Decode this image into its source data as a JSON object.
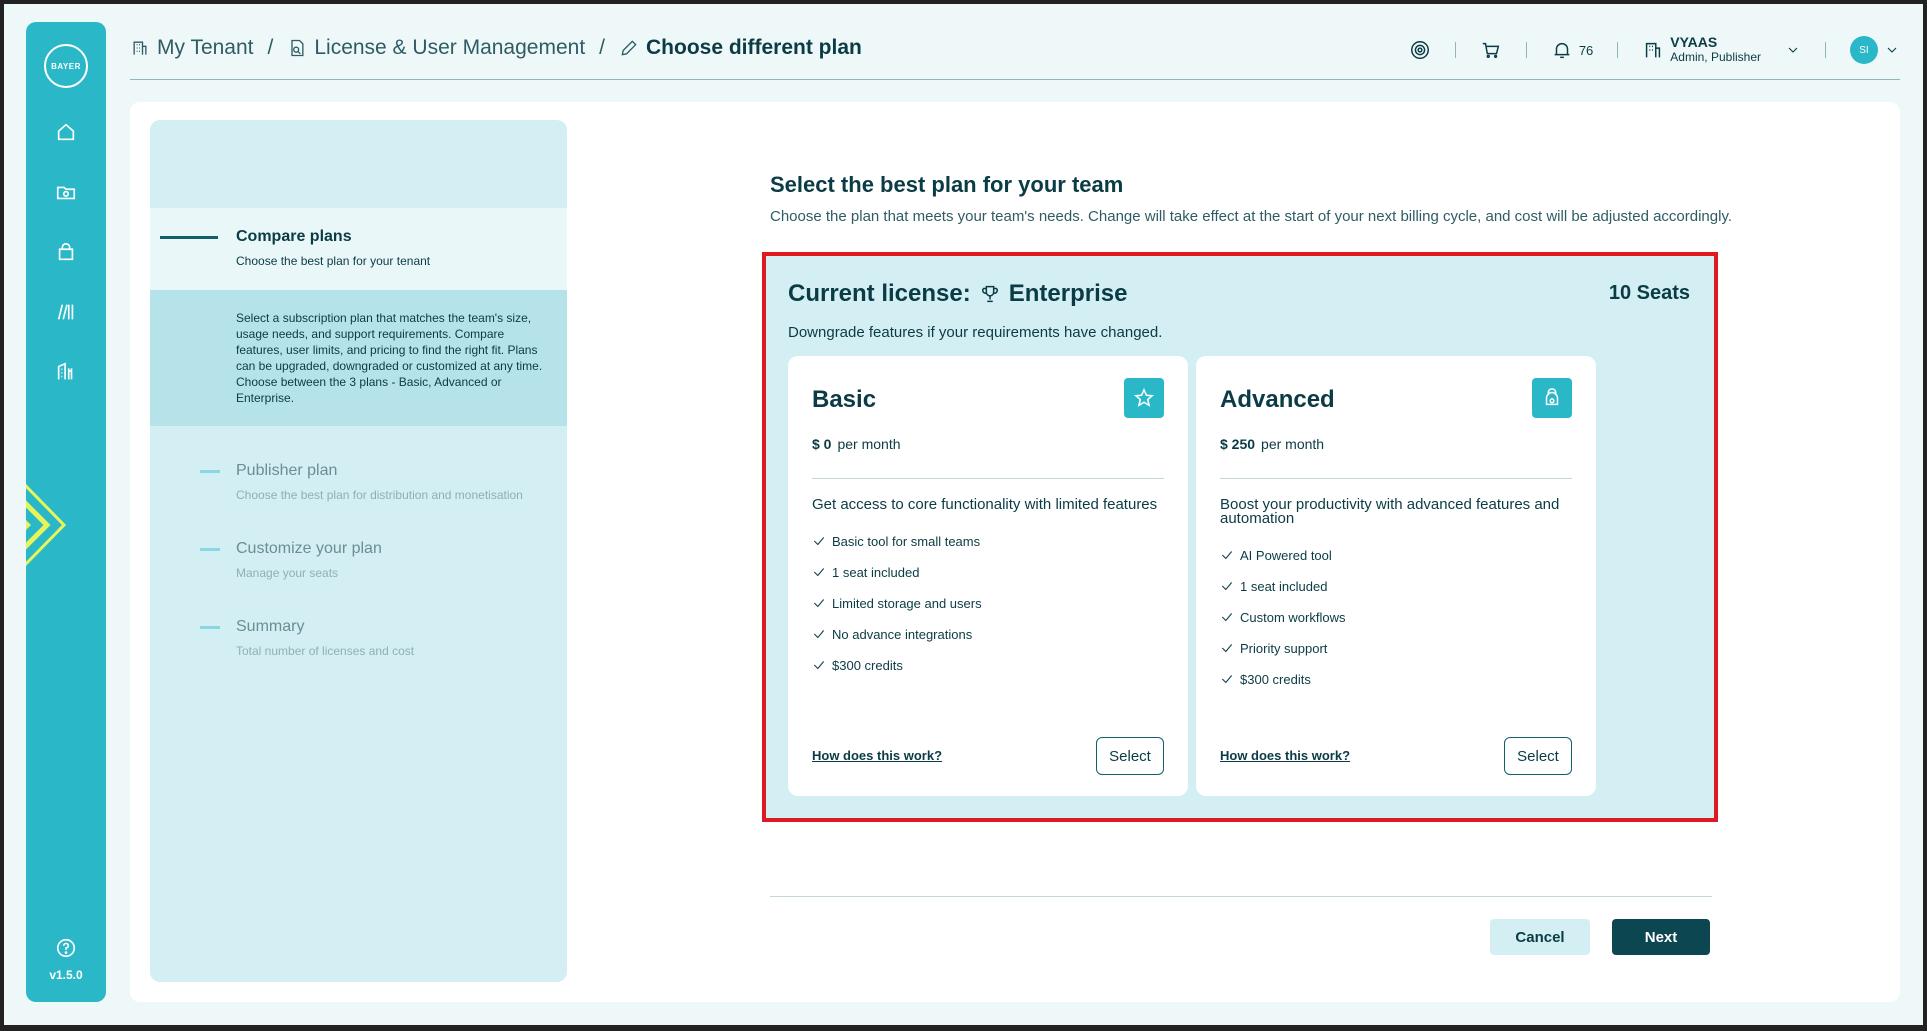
{
  "sidebar": {
    "logo_text": "BAYER",
    "version": "v1.5.0",
    "items": [
      {
        "icon": "home-icon"
      },
      {
        "icon": "folder-icon"
      },
      {
        "icon": "bag-icon"
      },
      {
        "icon": "library-icon"
      },
      {
        "icon": "building-tools-icon"
      }
    ],
    "help_icon": "help-icon"
  },
  "breadcrumb": {
    "items": [
      "My Tenant",
      "License & User Management",
      "Choose different plan"
    ],
    "separator": "/"
  },
  "header": {
    "notifications_count": "76",
    "user_name": "VYAAS",
    "user_role": "Admin, Publisher",
    "avatar_initials": "SI"
  },
  "stepper": {
    "steps": [
      {
        "title": "Compare plans",
        "subtitle": "Choose the best plan for your tenant"
      },
      {
        "title": "Publisher plan",
        "subtitle": "Choose the best plan for distribution and monetisation"
      },
      {
        "title": "Customize your plan",
        "subtitle": "Manage your seats"
      },
      {
        "title": "Summary",
        "subtitle": "Total number of licenses and cost"
      }
    ],
    "active_description": "Select a subscription plan that matches the team's size, usage needs, and support requirements. Compare features, user limits, and pricing to find the right fit. Plans can be upgraded, downgraded or customized at any time. Choose between the 3 plans - Basic, Advanced or Enterprise."
  },
  "main": {
    "heading": "Select the best plan for your team",
    "subheading": "Choose the plan that meets your team's needs. Change will take effect at the start of your next billing cycle, and cost will be adjusted accordingly."
  },
  "license": {
    "label": "Current license:",
    "plan": "Enterprise",
    "seats": "10 Seats",
    "subtitle": "Downgrade features if your requirements have changed."
  },
  "plans": [
    {
      "name": "Basic",
      "icon": "star-icon",
      "price": "$ 0",
      "period": "per month",
      "description": "Get access to core functionality with limited features",
      "features": [
        "Basic tool for small teams",
        "1 seat included",
        "Limited storage and users",
        "No advance integrations",
        "$300 credits"
      ],
      "how_link": "How does this work?",
      "select_label": "Select"
    },
    {
      "name": "Advanced",
      "icon": "kettlebell-icon",
      "price": "$ 250",
      "period": "per month",
      "description": "Boost your productivity with advanced features and automation",
      "features": [
        "AI Powered tool",
        "1 seat included",
        "Custom workflows",
        "Priority support",
        "$300 credits"
      ],
      "how_link": "How does this work?",
      "select_label": "Select"
    }
  ],
  "actions": {
    "cancel_label": "Cancel",
    "next_label": "Next"
  },
  "colors": {
    "brand": "#2ab8c8",
    "dark": "#0b3b44",
    "highlight_border": "#e0181f",
    "panel_tint": "#d3eff3"
  }
}
